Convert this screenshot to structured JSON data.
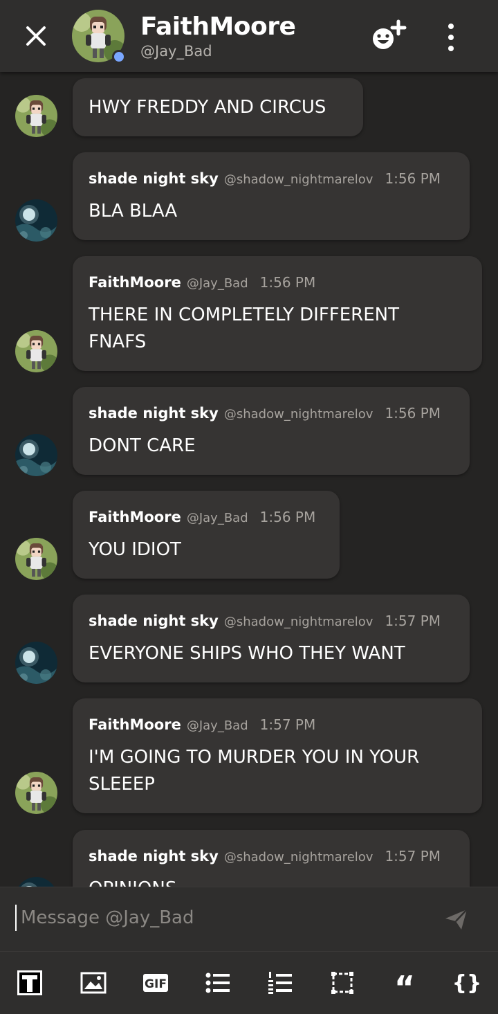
{
  "header": {
    "name": "FaithMoore",
    "handle": "@Jay_Bad",
    "close_icon": "close-icon",
    "add_reaction_icon": "emoji-add-icon",
    "more_icon": "more-vertical-icon",
    "presence_color": "#7aa7ff"
  },
  "messages": [
    {
      "avatar": "faith",
      "author": "",
      "handle": "",
      "time": "",
      "text": "HWY FREDDY AND CIRCUS"
    },
    {
      "avatar": "shade",
      "author": "shade night sky",
      "handle": "@shadow_nightmarelov",
      "time": "1:56 PM",
      "text": "BLA BLAA"
    },
    {
      "avatar": "faith",
      "author": "FaithMoore",
      "handle": "@Jay_Bad",
      "time": "1:56 PM",
      "text": "THERE IN COMPLETELY DIFFERENT\nFNAFS"
    },
    {
      "avatar": "shade",
      "author": "shade night sky",
      "handle": "@shadow_nightmarelov",
      "time": "1:56 PM",
      "text": "DONT CARE"
    },
    {
      "avatar": "faith",
      "author": "FaithMoore",
      "handle": "@Jay_Bad",
      "time": "1:56 PM",
      "text": "YOU IDIOT"
    },
    {
      "avatar": "shade",
      "author": "shade night sky",
      "handle": "@shadow_nightmarelov",
      "time": "1:57 PM",
      "text": "EVERYONE SHIPS WHO THEY WANT"
    },
    {
      "avatar": "faith",
      "author": "FaithMoore",
      "handle": "@Jay_Bad",
      "time": "1:57 PM",
      "text": "I'M GOING TO MURDER YOU IN YOUR\nSLEEEP"
    },
    {
      "avatar": "shade",
      "author": "shade night sky",
      "handle": "@shadow_nightmarelov",
      "time": "1:57 PM",
      "text": "OPINIONS"
    }
  ],
  "composer": {
    "placeholder": "Message @Jay_Bad",
    "send_icon": "send-icon"
  },
  "toolbar": {
    "items": [
      "text-format-icon",
      "image-icon",
      "gif-icon",
      "bullet-list-icon",
      "numbered-list-icon",
      "spoiler-icon",
      "quote-icon",
      "code-icon"
    ],
    "gif_label": "GIF",
    "quote_glyph": "“",
    "code_glyph": "{}"
  }
}
